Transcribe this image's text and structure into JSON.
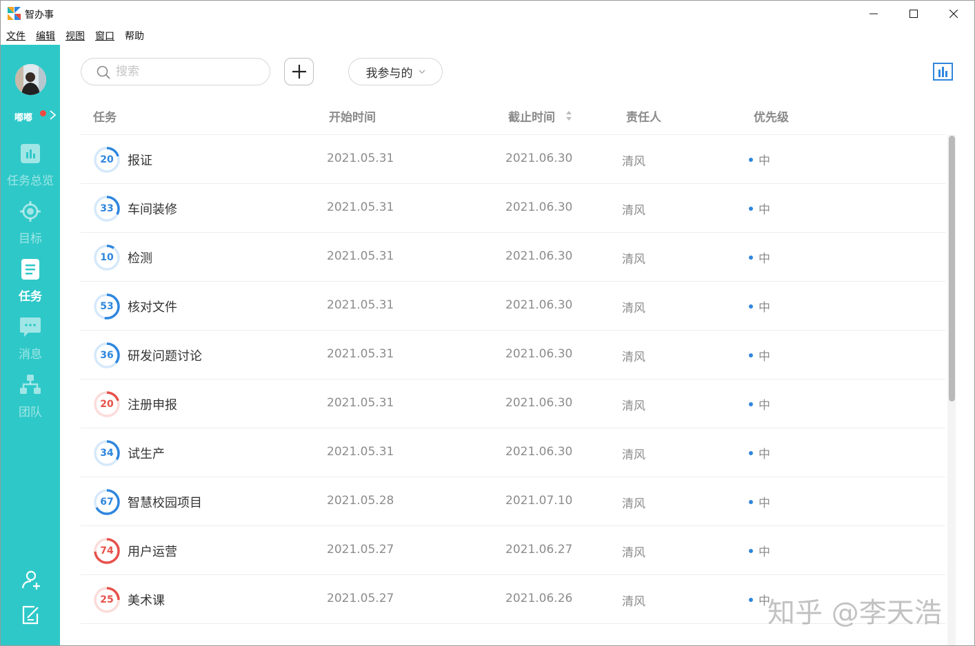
{
  "window": {
    "title": "智办事"
  },
  "menu": [
    {
      "label": "文件"
    },
    {
      "label": "编辑"
    },
    {
      "label": "视图"
    },
    {
      "label": "窗口"
    },
    {
      "label": "帮助"
    }
  ],
  "sidebar": {
    "user_name": "嘟嘟",
    "nav": [
      {
        "label": "任务总览",
        "icon": "bar-chart-icon",
        "active": false
      },
      {
        "label": "目标",
        "icon": "target-icon",
        "active": false
      },
      {
        "label": "任务",
        "icon": "task-list-icon",
        "active": true
      },
      {
        "label": "消息",
        "icon": "message-icon",
        "active": false
      },
      {
        "label": "团队",
        "icon": "team-icon",
        "active": false
      }
    ],
    "bottom_icons": [
      "add-user-icon",
      "edit-icon"
    ],
    "color": "#2fc8c8"
  },
  "toolbar": {
    "search_placeholder": "搜索",
    "filter_label": "我参与的"
  },
  "table": {
    "headers": {
      "task": "任务",
      "start": "开始时间",
      "end": "截止时间",
      "owner": "责任人",
      "priority": "优先级"
    },
    "rows": [
      {
        "progress": 20,
        "name": "报证",
        "start": "2021.05.31",
        "end": "2021.06.30",
        "owner": "清风",
        "priority": "中",
        "status_color": "#2e86de"
      },
      {
        "progress": 33,
        "name": "车间装修",
        "start": "2021.05.31",
        "end": "2021.06.30",
        "owner": "清风",
        "priority": "中",
        "status_color": "#2e86de"
      },
      {
        "progress": 10,
        "name": "检测",
        "start": "2021.05.31",
        "end": "2021.06.30",
        "owner": "清风",
        "priority": "中",
        "status_color": "#2e86de"
      },
      {
        "progress": 53,
        "name": "核对文件",
        "start": "2021.05.31",
        "end": "2021.06.30",
        "owner": "清风",
        "priority": "中",
        "status_color": "#2e86de"
      },
      {
        "progress": 36,
        "name": "研发问题讨论",
        "start": "2021.05.31",
        "end": "2021.06.30",
        "owner": "清风",
        "priority": "中",
        "status_color": "#2e86de"
      },
      {
        "progress": 20,
        "name": "注册申报",
        "start": "2021.05.31",
        "end": "2021.06.30",
        "owner": "清风",
        "priority": "中",
        "status_color": "#e8504a"
      },
      {
        "progress": 34,
        "name": "试生产",
        "start": "2021.05.31",
        "end": "2021.06.30",
        "owner": "清风",
        "priority": "中",
        "status_color": "#2e86de"
      },
      {
        "progress": 67,
        "name": "智慧校园项目",
        "start": "2021.05.28",
        "end": "2021.07.10",
        "owner": "清风",
        "priority": "中",
        "status_color": "#2e86de"
      },
      {
        "progress": 74,
        "name": "用户运营",
        "start": "2021.05.27",
        "end": "2021.06.27",
        "owner": "清风",
        "priority": "中",
        "status_color": "#e8504a"
      },
      {
        "progress": 25,
        "name": "美术课",
        "start": "2021.05.27",
        "end": "2021.06.26",
        "owner": "清风",
        "priority": "中",
        "status_color": "#e8504a"
      }
    ]
  },
  "watermark": "知乎 @李天浩"
}
